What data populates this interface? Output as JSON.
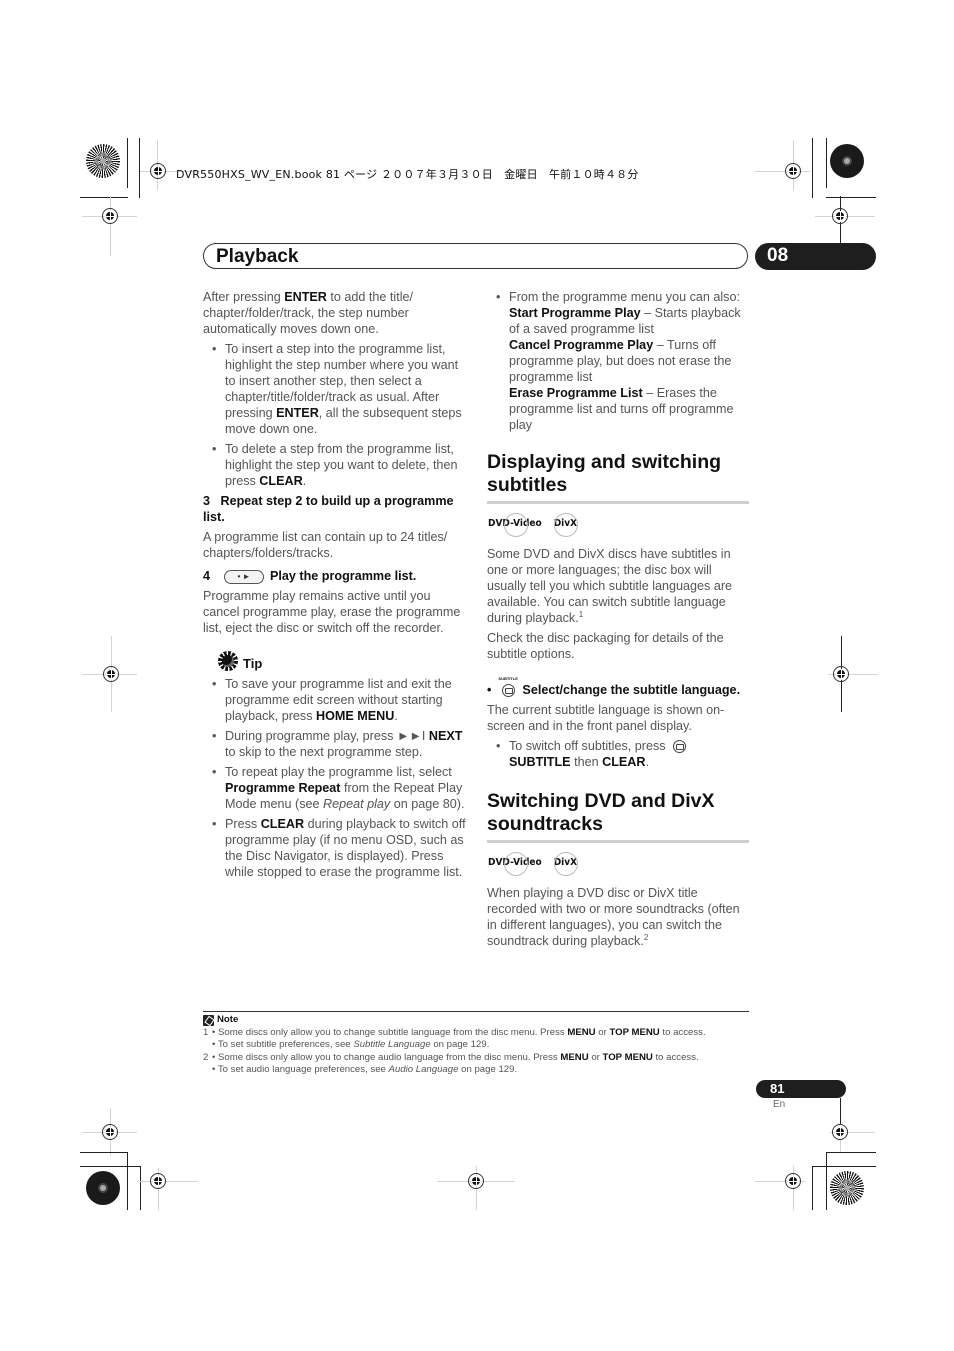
{
  "print_header": "DVR550HXS_WV_EN.book  81 ページ  ２００７年３月３０日　金曜日　午前１０時４８分",
  "chapter": {
    "title": "Playback",
    "number": "08"
  },
  "left_column": {
    "intro": [
      "After pressing ",
      "ENTER",
      " to add the title/ chapter/folder/track, the step number automatically moves down one."
    ],
    "bullets": [
      {
        "parts": [
          "To insert a step into the programme list, highlight the step number where you want to insert another step, then select a chapter/title/folder/track as usual. After pressing ",
          "ENTER",
          ", all the subsequent steps move down one."
        ]
      },
      {
        "parts": [
          "To delete a step from the programme list, highlight the step you want to delete, then press ",
          "CLEAR",
          "."
        ]
      }
    ],
    "step3": {
      "number": "3",
      "title": "Repeat step 2 to build up a programme list.",
      "body": "A programme list can contain up to 24 titles/ chapters/folders/tracks."
    },
    "step4": {
      "number": "4",
      "key_icon": "play-button",
      "title": "Play the programme list.",
      "body": "Programme play remains active until you cancel programme play, erase the programme list, eject the disc or switch off the recorder."
    },
    "tip": {
      "label": "Tip",
      "bullets": [
        {
          "parts": [
            "To save your programme list and exit the programme edit screen without starting playback, press ",
            "HOME MENU",
            "."
          ]
        },
        {
          "parts": [
            "During programme play, press ►►I ",
            "NEXT",
            " to skip to the next programme step."
          ]
        },
        {
          "parts": [
            "To repeat play the programme list, select ",
            "Programme Repeat",
            " from the Repeat Play Mode menu (see ",
            "Repeat play",
            " on page 80)."
          ]
        },
        {
          "parts": [
            "Press ",
            "CLEAR",
            " during playback to switch off programme play (if no menu OSD, such as the Disc Navigator, is displayed). Press while stopped to erase the programme list."
          ]
        }
      ]
    }
  },
  "right_column": {
    "menu_bullet": {
      "intro": "From the programme menu you can also:",
      "items": [
        {
          "name": "Start Programme Play",
          "desc": " – Starts playback of a saved programme list"
        },
        {
          "name": "Cancel Programme Play",
          "desc": " – Turns off programme play, but does not erase the programme list"
        },
        {
          "name": "Erase Programme List",
          "desc": " – Erases the programme list and turns off programme play"
        }
      ]
    },
    "section1": {
      "heading": "Displaying and switching subtitles",
      "badges": [
        "DVD-Video",
        "DivX"
      ],
      "para1": "Some DVD and DivX discs have subtitles in one or more languages; the disc box will usually tell you which subtitle languages are available. You can switch subtitle language during playback.",
      "para1_footnote": "1",
      "para2": "Check the disc packaging for details of the subtitle options.",
      "action": {
        "key_label": "SUBTITLE",
        "title": "Select/change the subtitle language."
      },
      "action_body": "The current subtitle language is shown on-screen and in the front panel display.",
      "bullet": [
        "To switch off subtitles, press ",
        "SUBTITLE",
        " then ",
        "CLEAR",
        "."
      ]
    },
    "section2": {
      "heading": "Switching DVD and DivX soundtracks",
      "badges": [
        "DVD-Video",
        "DivX"
      ],
      "para": "When playing a DVD disc or DivX title recorded with two or more soundtracks (often in different languages), you can switch the soundtrack during playback.",
      "para_footnote": "2"
    }
  },
  "notes": {
    "label": "Note",
    "items": [
      {
        "num": "1",
        "lines": [
          [
            "Some discs only allow you to change subtitle language from the disc menu. Press ",
            "MENU",
            " or ",
            "TOP MENU",
            " to access."
          ],
          [
            "To set subtitle preferences, see ",
            "Subtitle Language",
            " on page 129."
          ]
        ]
      },
      {
        "num": "2",
        "lines": [
          [
            "Some discs only allow you to change audio language from the disc menu. Press ",
            "MENU",
            " or ",
            "TOP MENU",
            " to access."
          ],
          [
            "To set audio language preferences, see ",
            "Audio Language",
            " on page 129."
          ]
        ]
      }
    ]
  },
  "page": {
    "number": "81",
    "lang": "En"
  }
}
